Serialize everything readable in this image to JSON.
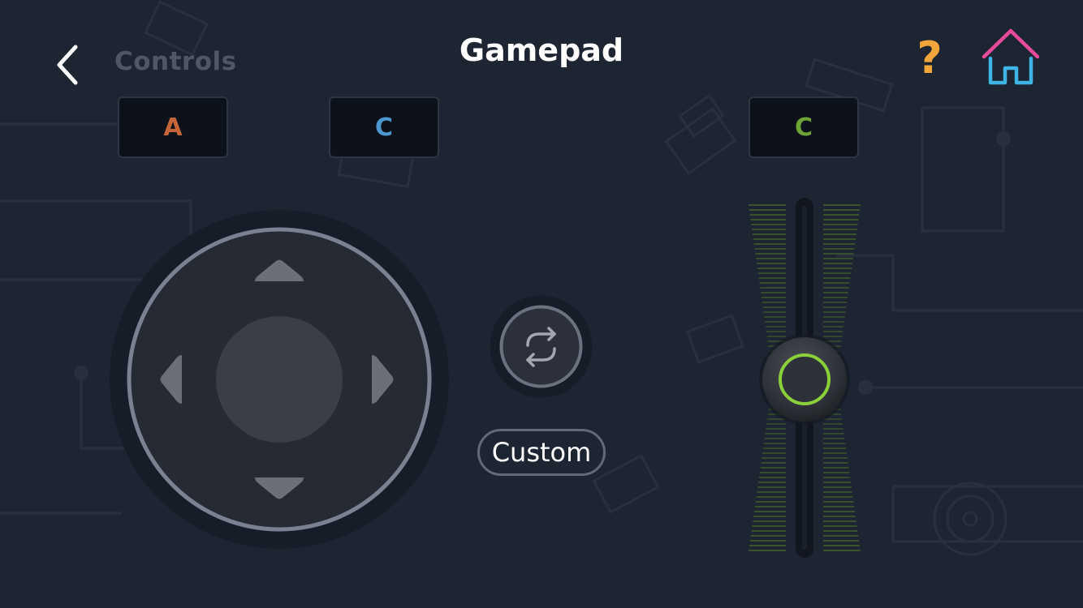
{
  "header": {
    "back_label": "Controls",
    "title": "Gamepad",
    "help_label": "?"
  },
  "keys": [
    {
      "label": "A",
      "color": "#c4653a"
    },
    {
      "label": "C",
      "color": "#4d97d1"
    },
    {
      "label": "C",
      "color": "#6ca535"
    }
  ],
  "dpad": {
    "directions": [
      "up",
      "down",
      "left",
      "right"
    ]
  },
  "mode": {
    "label": "Custom"
  },
  "slider": {
    "value": 0.5,
    "ring_color": "#8ad03a"
  },
  "colors": {
    "background": "#1e2532",
    "home_roof": "#e64a9a",
    "home_body": "#3fb4e6",
    "help": "#f0a63a"
  },
  "icons": {
    "back": "chevron-left-icon",
    "help": "question-mark-icon",
    "home": "home-icon",
    "swap": "swap-arrows-icon"
  }
}
